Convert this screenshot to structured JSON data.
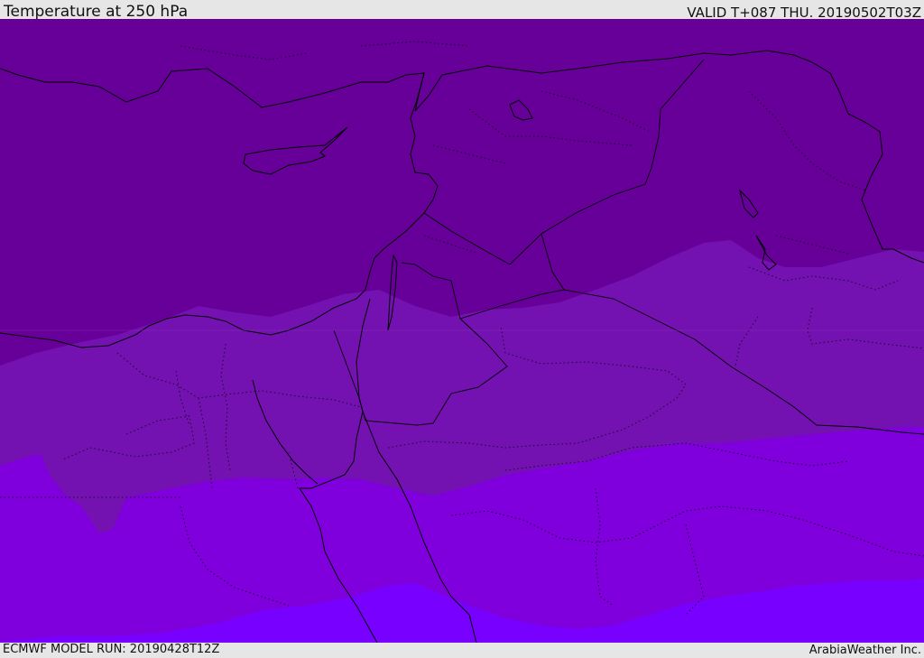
{
  "header": {
    "title": "Temperature at 250 hPa",
    "valid": "VALID T+087 THU. 20190502T03Z"
  },
  "footer": {
    "model_run": "ECMWF MODEL RUN: 20190428T12Z",
    "credit": "ArabiaWeather Inc."
  },
  "colors": {
    "band_coldest": "#660099",
    "band_cold": "#7311b1",
    "band_mid": "#7f00dc",
    "band_warm": "#7700ff",
    "bar_background": "#e6e6e6"
  }
}
